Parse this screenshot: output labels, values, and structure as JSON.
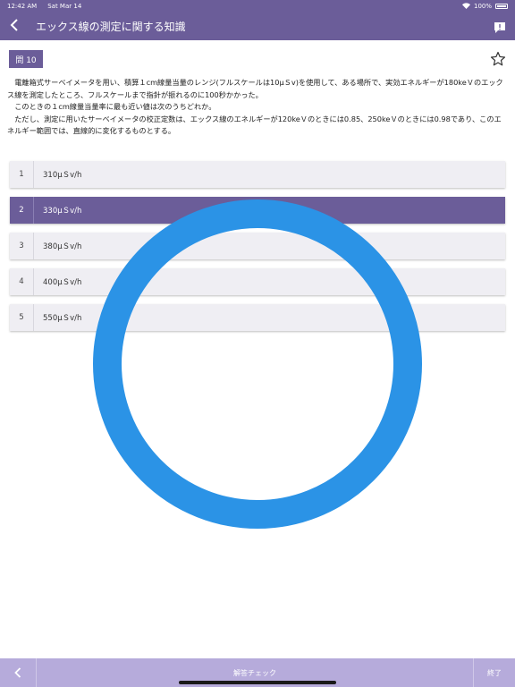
{
  "status_bar": {
    "time": "12:42 AM",
    "date": "Sat Mar 14",
    "battery": "100%"
  },
  "nav": {
    "title": "エックス線の測定に関する知識",
    "back_icon": "chevron-left-icon",
    "comment_icon": "comment-icon"
  },
  "question": {
    "badge": "問 10",
    "paragraphs": [
      "電離箱式サーベイメータを用い、積算１cm線量当量のレンジ(フルスケールは10μＳv)を使用して、ある場所で、実効エネルギーが180keＶのエックス線を測定したところ、フルスケールまで指針が振れるのに100秒かかった。",
      "このときの１cm線量当量率に最も近い値は次のうちどれか。",
      "ただし、測定に用いたサーベイメータの校正定数は、エックス線のエネルギーが120keＶのときには0.85、250keＶのときには0.98であり、このエネルギー範囲では、直線的に変化するものとする。"
    ],
    "star_icon": "star-icon"
  },
  "choices": [
    {
      "num": "1",
      "label": "310μＳv/h",
      "selected": false
    },
    {
      "num": "2",
      "label": "330μＳv/h",
      "selected": true
    },
    {
      "num": "3",
      "label": "380μＳv/h",
      "selected": false
    },
    {
      "num": "4",
      "label": "400μＳv/h",
      "selected": false
    },
    {
      "num": "5",
      "label": "550μＳv/h",
      "selected": false
    }
  ],
  "bottom_bar": {
    "check_label": "解答チェック",
    "end_label": "終了"
  },
  "colors": {
    "primary": "#6b5d99",
    "bottom_bar": "#b6abdb",
    "ring": "#2b93e6",
    "choice_bg": "#efeef3"
  }
}
